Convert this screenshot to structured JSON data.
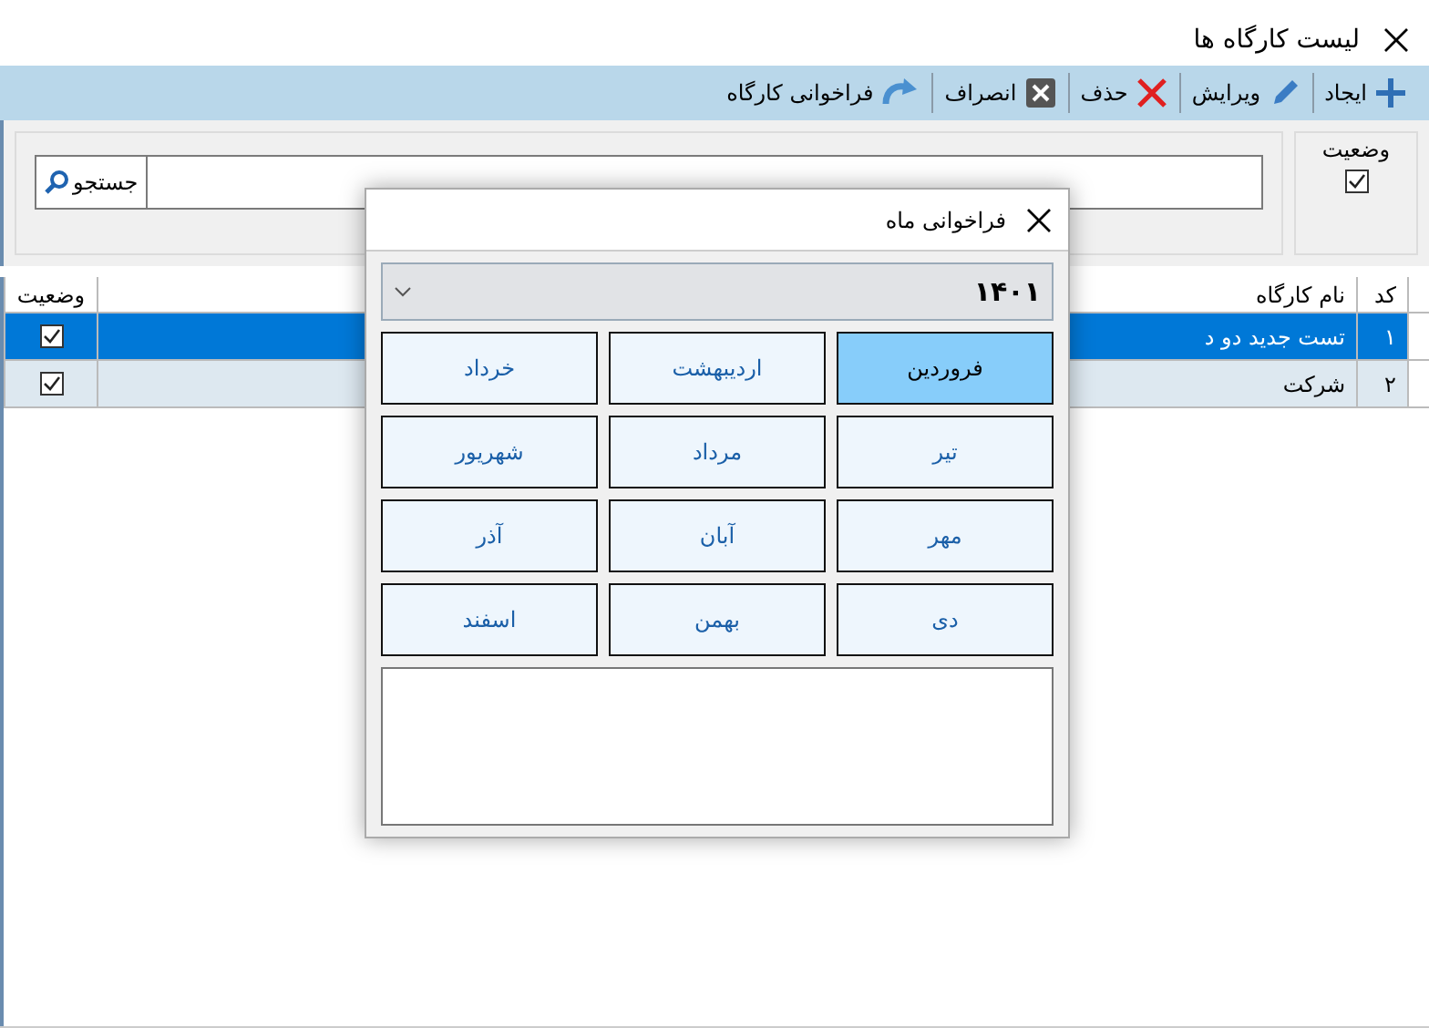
{
  "window": {
    "title": "لیست کارگاه ها"
  },
  "toolbar": [
    {
      "kind": "create",
      "label": "ایجاد"
    },
    {
      "kind": "edit",
      "label": "ویرایش"
    },
    {
      "kind": "delete",
      "label": "حذف"
    },
    {
      "kind": "cancel",
      "label": "انصراف"
    },
    {
      "kind": "reload",
      "label": "فراخوانی کارگاه"
    }
  ],
  "filter": {
    "status_label": "وضعیت",
    "status_checked": true,
    "search_button": "جستجو"
  },
  "table": {
    "columns": [
      "کد",
      "نام کارگاه",
      "وضعیت"
    ],
    "rows": [
      {
        "code": "۱",
        "name": "تست جدید دو د",
        "status_checked": true,
        "selected": true
      },
      {
        "code": "۲",
        "name": "شرکت",
        "status_checked": true,
        "selected": false
      }
    ]
  },
  "dialog": {
    "title": "فراخوانی ماه",
    "year": "۱۴۰۱",
    "months": [
      {
        "label": "فروردین",
        "selected": true
      },
      {
        "label": "اردیبهشت",
        "selected": false
      },
      {
        "label": "خرداد",
        "selected": false
      },
      {
        "label": "تیر",
        "selected": false
      },
      {
        "label": "مرداد",
        "selected": false
      },
      {
        "label": "شهریور",
        "selected": false
      },
      {
        "label": "مهر",
        "selected": false
      },
      {
        "label": "آبان",
        "selected": false
      },
      {
        "label": "آذر",
        "selected": false
      },
      {
        "label": "دی",
        "selected": false
      },
      {
        "label": "بهمن",
        "selected": false
      },
      {
        "label": "اسفند",
        "selected": false
      }
    ]
  }
}
